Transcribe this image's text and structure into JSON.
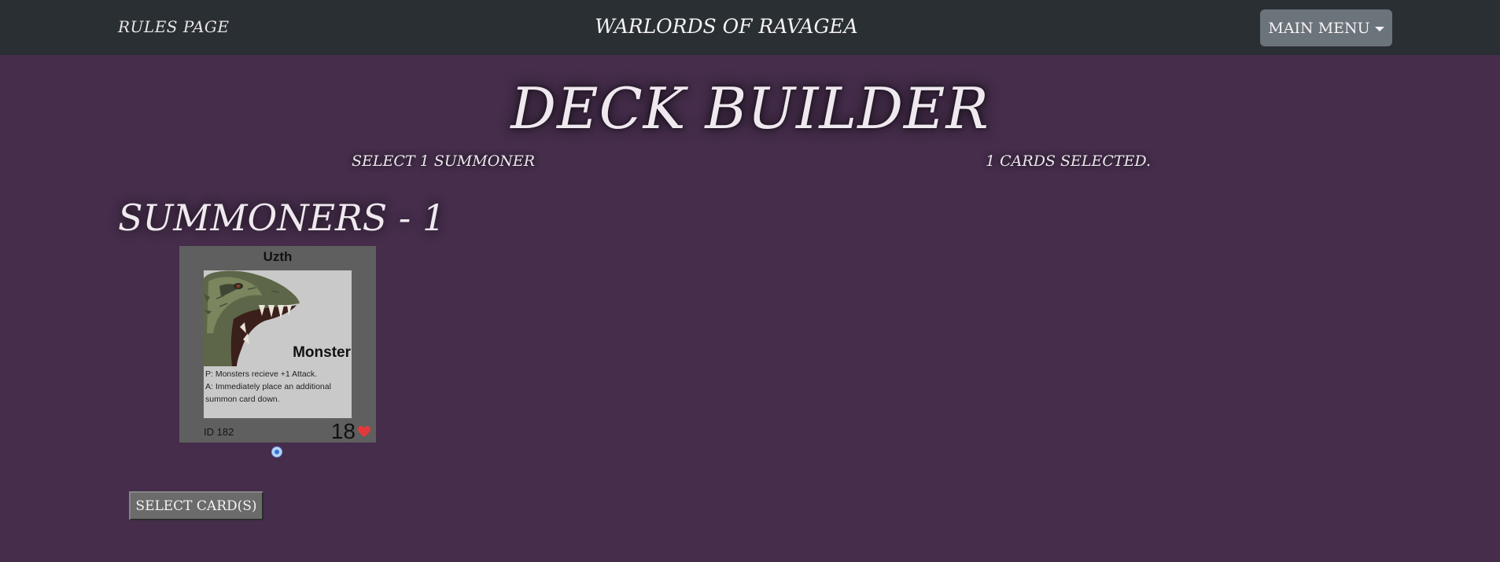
{
  "nav": {
    "rules_link": "Rules Page",
    "brand": "Warlords of Ravagea",
    "main_menu": "Main Menu",
    "caret_icon": "caret-down-icon"
  },
  "page": {
    "title": "Deck Builder",
    "instruction": "Select 1 Summoner",
    "selection_status": "1 cards selected."
  },
  "section": {
    "title": "Summoners - 1"
  },
  "cards": [
    {
      "name": "Uzth",
      "type": "Monster",
      "art_icon": "dragon-head-icon",
      "passive": "P: Monsters recieve +1 Attack.",
      "ability": "A: Immediately place an additional summon card down.",
      "id_label": "ID 182",
      "health": "18",
      "health_icon": "heart-icon",
      "selected": true
    }
  ],
  "actions": {
    "select_button": "Select Card(s)"
  },
  "colors": {
    "background": "#452d4b",
    "navbar": "#2a2f33",
    "menu_button": "#6b737b",
    "card_frame": "#5f5f5f",
    "card_face": "#c9c9c9",
    "heart": "#e23a3a"
  }
}
